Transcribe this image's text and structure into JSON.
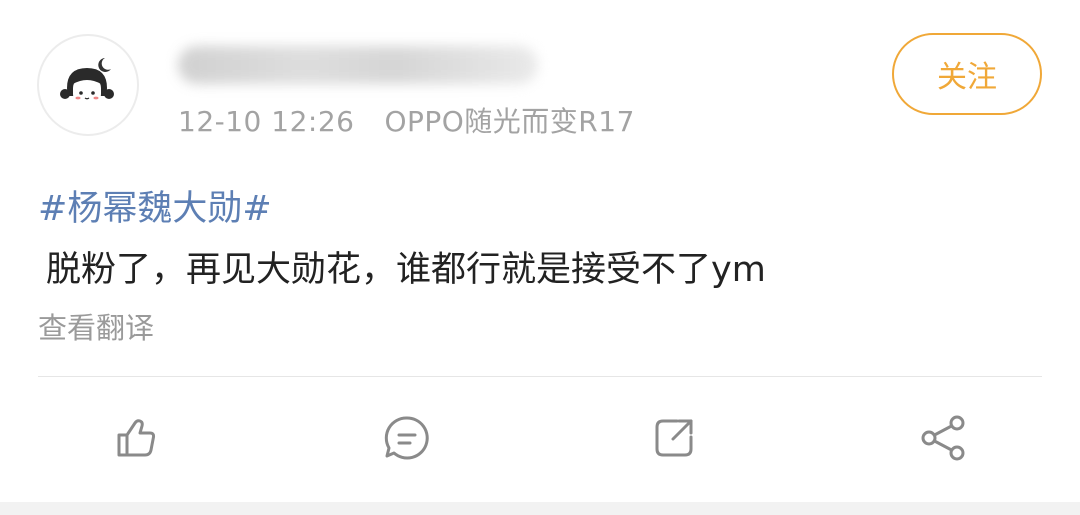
{
  "post": {
    "timestamp": "12-10 12:26",
    "device": "OPPO随光而变R17",
    "follow_label": "关注",
    "hashtag": "#杨幂魏大勋#",
    "content": "脱粉了，再见大勋花，谁都行就是接受不了ym",
    "translate_label": "查看翻译"
  },
  "actions": [
    {
      "icon": "like-icon"
    },
    {
      "icon": "comment-icon"
    },
    {
      "icon": "repost-icon"
    },
    {
      "icon": "share-icon"
    }
  ],
  "colors": {
    "accent": "#f0a838",
    "hashtag": "#5d7fb4",
    "muted": "#a3a3a3"
  }
}
